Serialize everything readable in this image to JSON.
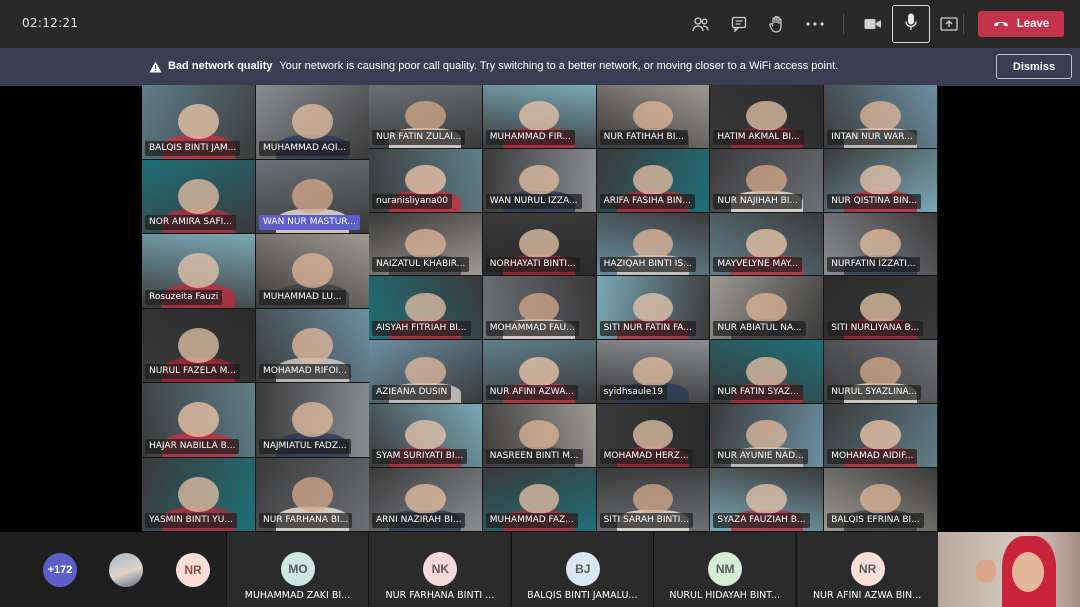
{
  "topbar": {
    "timer": "02:12:21",
    "icons": [
      "people-icon",
      "chat-icon",
      "raise-hand-icon",
      "more-icon",
      "camera-icon",
      "mic-icon",
      "share-icon"
    ],
    "leave_label": "Leave"
  },
  "banner": {
    "title": "Bad network quality",
    "message": "Your network is causing poor call quality. Try switching to a better network, or moving closer to a WiFi access point.",
    "dismiss_label": "Dismiss"
  },
  "colors": {
    "leave": "#c4314b",
    "banner": "#3b3e53",
    "accent": "#5b5fc7"
  },
  "left_tiles": [
    "BALQIS BINTI JAM...",
    "MUHAMMAD AQI...",
    "NOR AMIRA SAFI...",
    "WAN NUR MASTUR...",
    "Rosuzeita Fauzi",
    "MUHAMMAD LU...",
    "NURUL FAZELA M...",
    "MOHAMAD RIFOI...",
    "HAJAR NABILLA B...",
    "NAJMIATUL FADZ...",
    "YASMIN BINTI YU...",
    "NUR FARHANA BI..."
  ],
  "grid_tiles": [
    "NUR FATIN ZULAI...",
    "MUHAMMAD FIR...",
    "NUR FATIHAH BI...",
    "HATIM AKMAL BI...",
    "INTAN NUR WAR...",
    "nuranisliyana00",
    "WAN NURUL IZZA...",
    "ARIFA FASIHA BIN...",
    "NUR NAJIHAH BI...",
    "NUR QISTINA BIN...",
    "NAIZATUL KHABIR...",
    "NORHAYATI BINTI...",
    "HAZIQAH BINTI IS...",
    "MAYVELYNE MAY...",
    "NURFATIN IZZATI...",
    "AISYAH FITRIAH BI...",
    "MOHAMMAD FAU...",
    "SITI NUR FATIN FA...",
    "NUR ABIATUL NA...",
    "SITI NURLIYANA B...",
    "AZIEANA DUSIN",
    "NUR AFINI AZWA...",
    "syidhsaule19",
    "NUR FATIN SYAZ...",
    "NURUL SYAZLINA...",
    "SYAM SURIYATI BI...",
    "NASREEN BINTI M...",
    "MOHAMAD HERZ...",
    "NUR AYUNIE NAD...",
    "MOHAMAD AIDIF...",
    "ARNI NAZIRAH BI...",
    "MUHAMMAD FAZ...",
    "SITI SARAH BINTI...",
    "SYAZA FAUZIAH B...",
    "BALQIS EFRINA BI..."
  ],
  "bottom": {
    "overflow_count": "+172",
    "avatar_initials": "NR",
    "participants": [
      {
        "initials": "MO",
        "name": "MUHAMMAD ZAKI BI...",
        "color": "#cde8e3"
      },
      {
        "initials": "NK",
        "name": "NUR FARHANA BINTI ...",
        "color": "#f8d8d8"
      },
      {
        "initials": "BJ",
        "name": "BALQIS BINTI JAMALU...",
        "color": "#dbe7f3"
      },
      {
        "initials": "NM",
        "name": "NURUL HIDAYAH BINT...",
        "color": "#d6ecd7"
      },
      {
        "initials": "NR",
        "name": "NUR AFINI AZWA BIN...",
        "color": "#fbded7"
      }
    ]
  }
}
